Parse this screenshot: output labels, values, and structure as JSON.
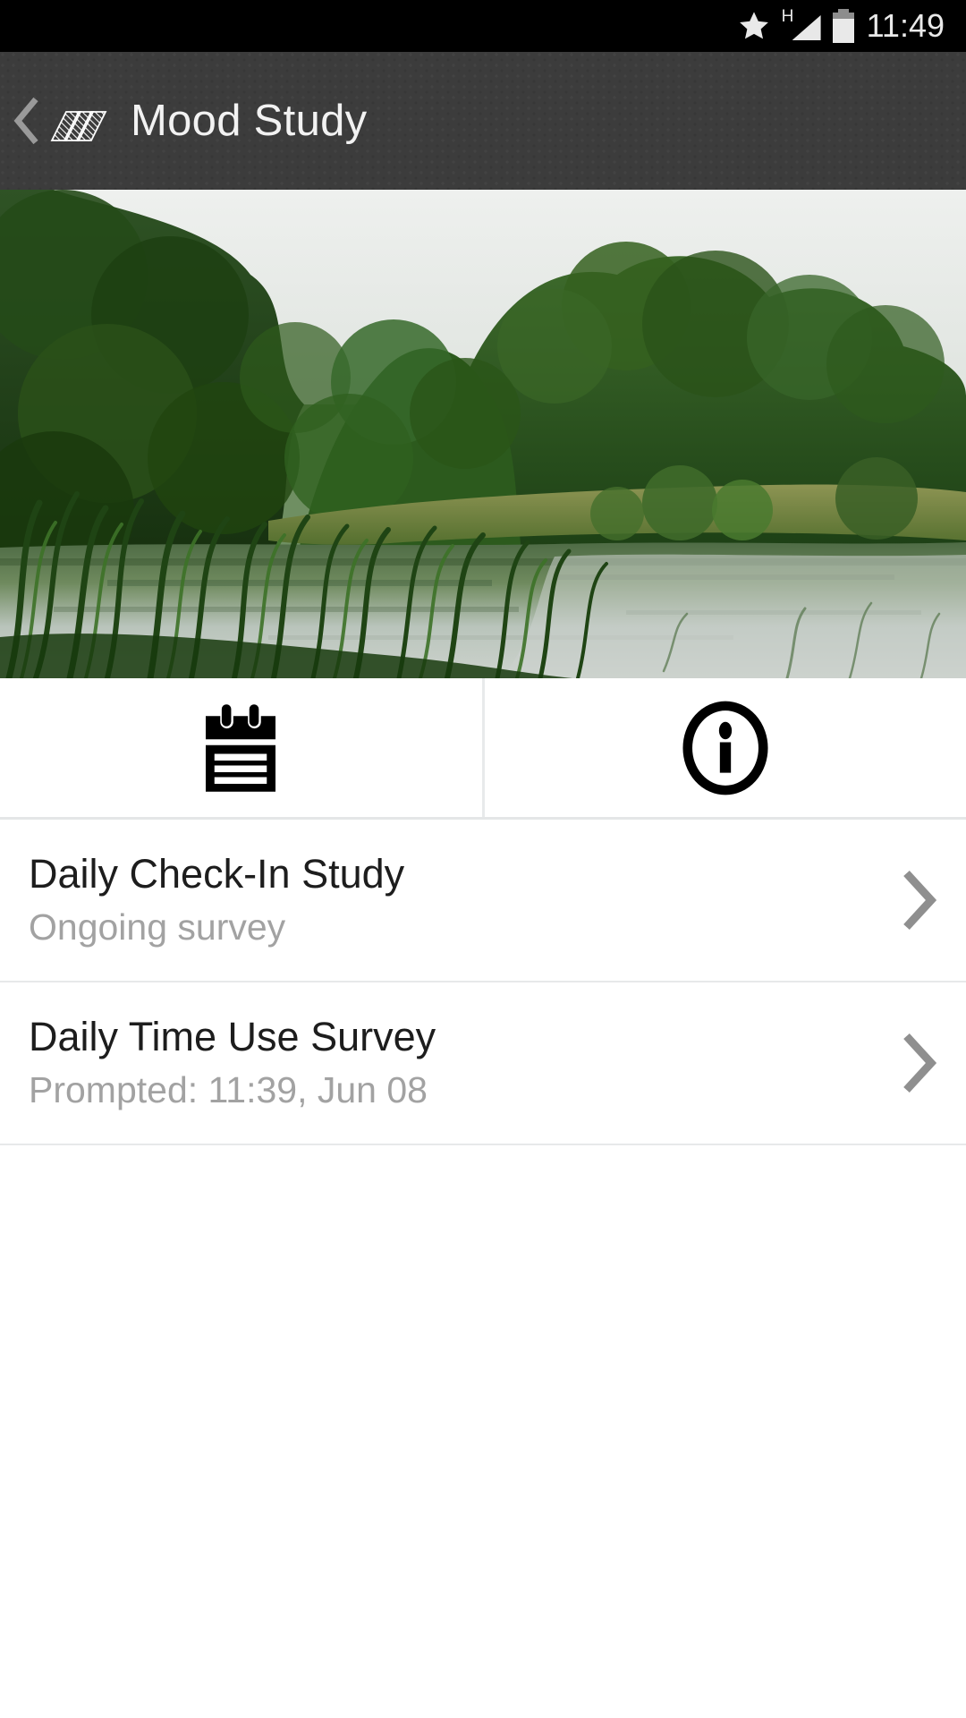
{
  "status_bar": {
    "icons": [
      "star-icon",
      "signal-h-icon",
      "battery-icon"
    ],
    "network_type": "H",
    "time": "11:49"
  },
  "action_bar": {
    "back_icon": "chevron-left-icon",
    "logo_icon": "stacked-cards-logo-icon",
    "title": "Mood Study"
  },
  "hero": {
    "alt": "lake-with-trees-photo"
  },
  "tabs": [
    {
      "icon": "notepad-icon",
      "name": "surveys-tab",
      "selected": true
    },
    {
      "icon": "info-circle-icon",
      "name": "info-tab",
      "selected": false
    }
  ],
  "surveys": [
    {
      "title": "Daily Check-In Study",
      "subtitle": "Ongoing survey",
      "chevron": "chevron-right-icon"
    },
    {
      "title": "Daily Time Use Survey",
      "subtitle": "Prompted: 11:39, Jun 08",
      "chevron": "chevron-right-icon"
    }
  ],
  "colors": {
    "status_bar_bg": "#000000",
    "action_bar_bg": "#3c3c3c",
    "action_bar_text": "#f2f2f2",
    "row_title": "#1d1d1d",
    "row_subtitle": "#a2a2a2",
    "divider": "#e7e9ea",
    "page_bg": "#ffffff",
    "chevron": "#8f8f8f"
  }
}
